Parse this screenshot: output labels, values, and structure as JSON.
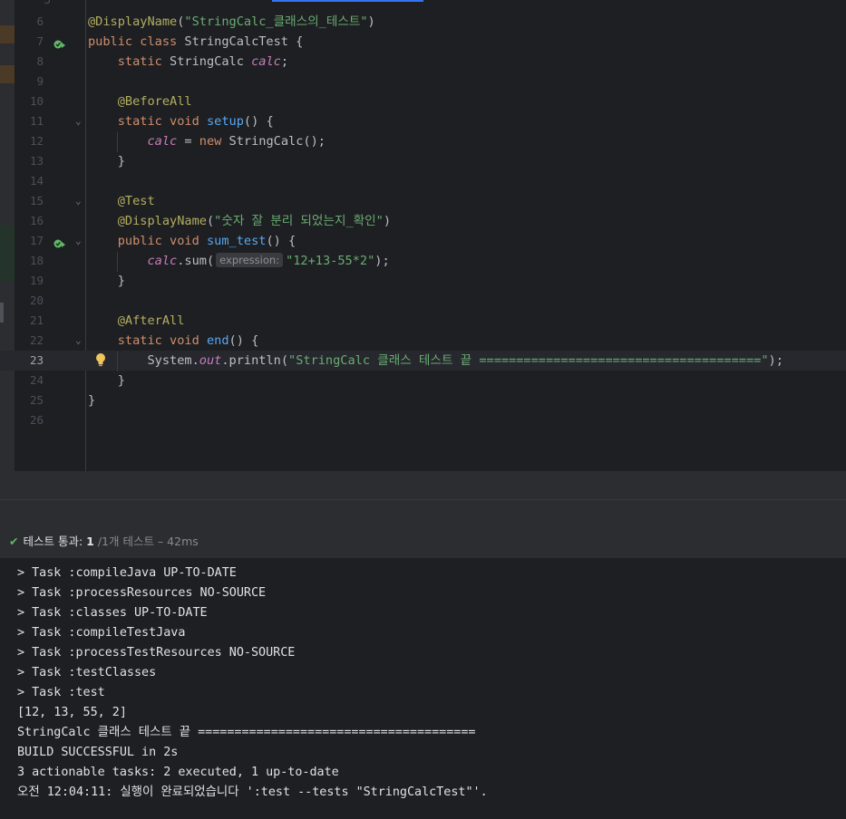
{
  "editor": {
    "lines": [
      {
        "n": "6",
        "tokens": [
          {
            "t": "@DisplayName",
            "c": "ann"
          },
          {
            "t": "(",
            "c": ""
          },
          {
            "t": "\"StringCalc_클래스의_테스트\"",
            "c": "str"
          },
          {
            "t": ")",
            "c": ""
          }
        ]
      },
      {
        "n": "7",
        "run_icon": true,
        "tokens": [
          {
            "t": "public class ",
            "c": "kw"
          },
          {
            "t": "StringCalcTest {",
            "c": ""
          }
        ]
      },
      {
        "n": "8",
        "tokens": [
          {
            "t": "    ",
            "c": ""
          },
          {
            "t": "static ",
            "c": "kw"
          },
          {
            "t": "StringCalc ",
            "c": ""
          },
          {
            "t": "calc",
            "c": "fld"
          },
          {
            "t": ";",
            "c": ""
          }
        ]
      },
      {
        "n": "9",
        "tokens": []
      },
      {
        "n": "10",
        "tokens": [
          {
            "t": "    ",
            "c": ""
          },
          {
            "t": "@BeforeAll",
            "c": "ann"
          }
        ]
      },
      {
        "n": "11",
        "fold": true,
        "tokens": [
          {
            "t": "    ",
            "c": ""
          },
          {
            "t": "static void ",
            "c": "kw"
          },
          {
            "t": "setup",
            "c": "fn"
          },
          {
            "t": "() {",
            "c": ""
          }
        ]
      },
      {
        "n": "12",
        "tokens": [
          {
            "t": "        ",
            "c": ""
          },
          {
            "t": "calc",
            "c": "fld"
          },
          {
            "t": " = ",
            "c": ""
          },
          {
            "t": "new ",
            "c": "kw"
          },
          {
            "t": "StringCalc();",
            "c": ""
          }
        ]
      },
      {
        "n": "13",
        "tokens": [
          {
            "t": "    }",
            "c": ""
          }
        ]
      },
      {
        "n": "14",
        "tokens": []
      },
      {
        "n": "15",
        "fold": true,
        "tokens": [
          {
            "t": "    ",
            "c": ""
          },
          {
            "t": "@Test",
            "c": "ann"
          }
        ]
      },
      {
        "n": "16",
        "tokens": [
          {
            "t": "    ",
            "c": ""
          },
          {
            "t": "@DisplayName",
            "c": "ann"
          },
          {
            "t": "(",
            "c": ""
          },
          {
            "t": "\"숫자 잘 분리 되었는지_확인\"",
            "c": "str"
          },
          {
            "t": ")",
            "c": ""
          }
        ]
      },
      {
        "n": "17",
        "run_icon": true,
        "fold": true,
        "tokens": [
          {
            "t": "    ",
            "c": ""
          },
          {
            "t": "public void ",
            "c": "kw"
          },
          {
            "t": "sum_test",
            "c": "fn"
          },
          {
            "t": "() {",
            "c": ""
          }
        ]
      },
      {
        "n": "18",
        "tokens": [
          {
            "t": "        ",
            "c": ""
          },
          {
            "t": "calc",
            "c": "fld"
          },
          {
            "t": ".sum(",
            "c": ""
          },
          {
            "t": "expression:",
            "c": "hint"
          },
          {
            "t": "\"12+13-55*2\"",
            "c": "str"
          },
          {
            "t": ");",
            "c": ""
          }
        ]
      },
      {
        "n": "19",
        "tokens": [
          {
            "t": "    }",
            "c": ""
          }
        ]
      },
      {
        "n": "20",
        "tokens": []
      },
      {
        "n": "21",
        "tokens": [
          {
            "t": "    ",
            "c": ""
          },
          {
            "t": "@AfterAll",
            "c": "ann"
          }
        ]
      },
      {
        "n": "22",
        "fold": true,
        "tokens": [
          {
            "t": "    ",
            "c": ""
          },
          {
            "t": "static void ",
            "c": "kw"
          },
          {
            "t": "end",
            "c": "fn"
          },
          {
            "t": "() {",
            "c": ""
          }
        ]
      },
      {
        "n": "23",
        "current": true,
        "bulb": true,
        "tokens": [
          {
            "t": "        ",
            "c": ""
          },
          {
            "t": "System.",
            "c": ""
          },
          {
            "t": "out",
            "c": "fld"
          },
          {
            "t": ".println(",
            "c": ""
          },
          {
            "t": "\"StringCalc 클래스 테스트 끝 ======================================\"",
            "c": "str"
          },
          {
            "t": ");",
            "c": ""
          }
        ]
      },
      {
        "n": "24",
        "tokens": [
          {
            "t": "    }",
            "c": ""
          }
        ]
      },
      {
        "n": "25",
        "tokens": [
          {
            "t": "}",
            "c": ""
          }
        ]
      },
      {
        "n": "26",
        "tokens": []
      }
    ]
  },
  "test_status": {
    "label": "테스트 통과:",
    "count": "1",
    "rest": "/1개 테스트 – 42ms"
  },
  "console": {
    "lines": [
      "> Task :compileJava UP-TO-DATE",
      "> Task :processResources NO-SOURCE",
      "> Task :classes UP-TO-DATE",
      "> Task :compileTestJava",
      "> Task :processTestResources NO-SOURCE",
      "> Task :testClasses",
      "> Task :test",
      "[12, 13, 55, 2]",
      "StringCalc 클래스 테스트 끝 ======================================",
      "BUILD SUCCESSFUL in 2s",
      "3 actionable tasks: 2 executed, 1 up-to-date",
      "오전 12:04:11: 실행이 완료되었습니다 ':test --tests \"StringCalcTest\"'."
    ]
  },
  "colors": {
    "editor_bg": "#1e1f22",
    "panel_bg": "#2b2d30",
    "annotation": "#b3ae60",
    "keyword": "#cf8e6d",
    "string": "#6aab73",
    "field": "#c77dbb",
    "method": "#56a8f5",
    "success": "#5fb865"
  }
}
